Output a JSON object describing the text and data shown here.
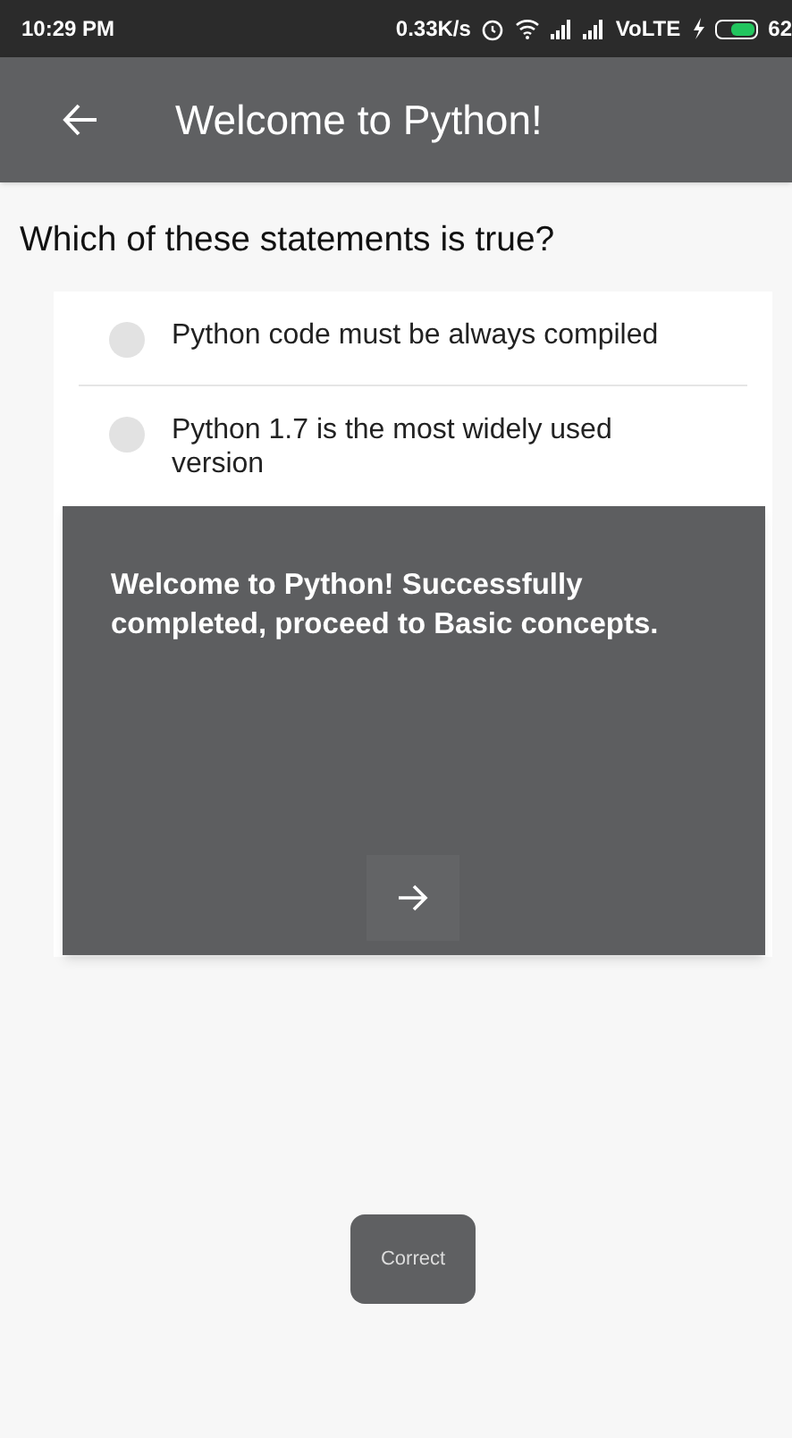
{
  "status_bar": {
    "time": "10:29 PM",
    "net_speed": "0.33K/s",
    "network": "VoLTE",
    "battery": "62"
  },
  "app_bar": {
    "title": "Welcome to Python!"
  },
  "question": "Which of these statements is true?",
  "options": [
    {
      "label": "Python code must be always compiled",
      "selected": false
    },
    {
      "label": "Python 1.7 is the most widely used version",
      "selected": false
    }
  ],
  "dialog": {
    "message": "Welcome to Python! Successfully completed, proceed to Basic concepts."
  },
  "toast": "Correct"
}
